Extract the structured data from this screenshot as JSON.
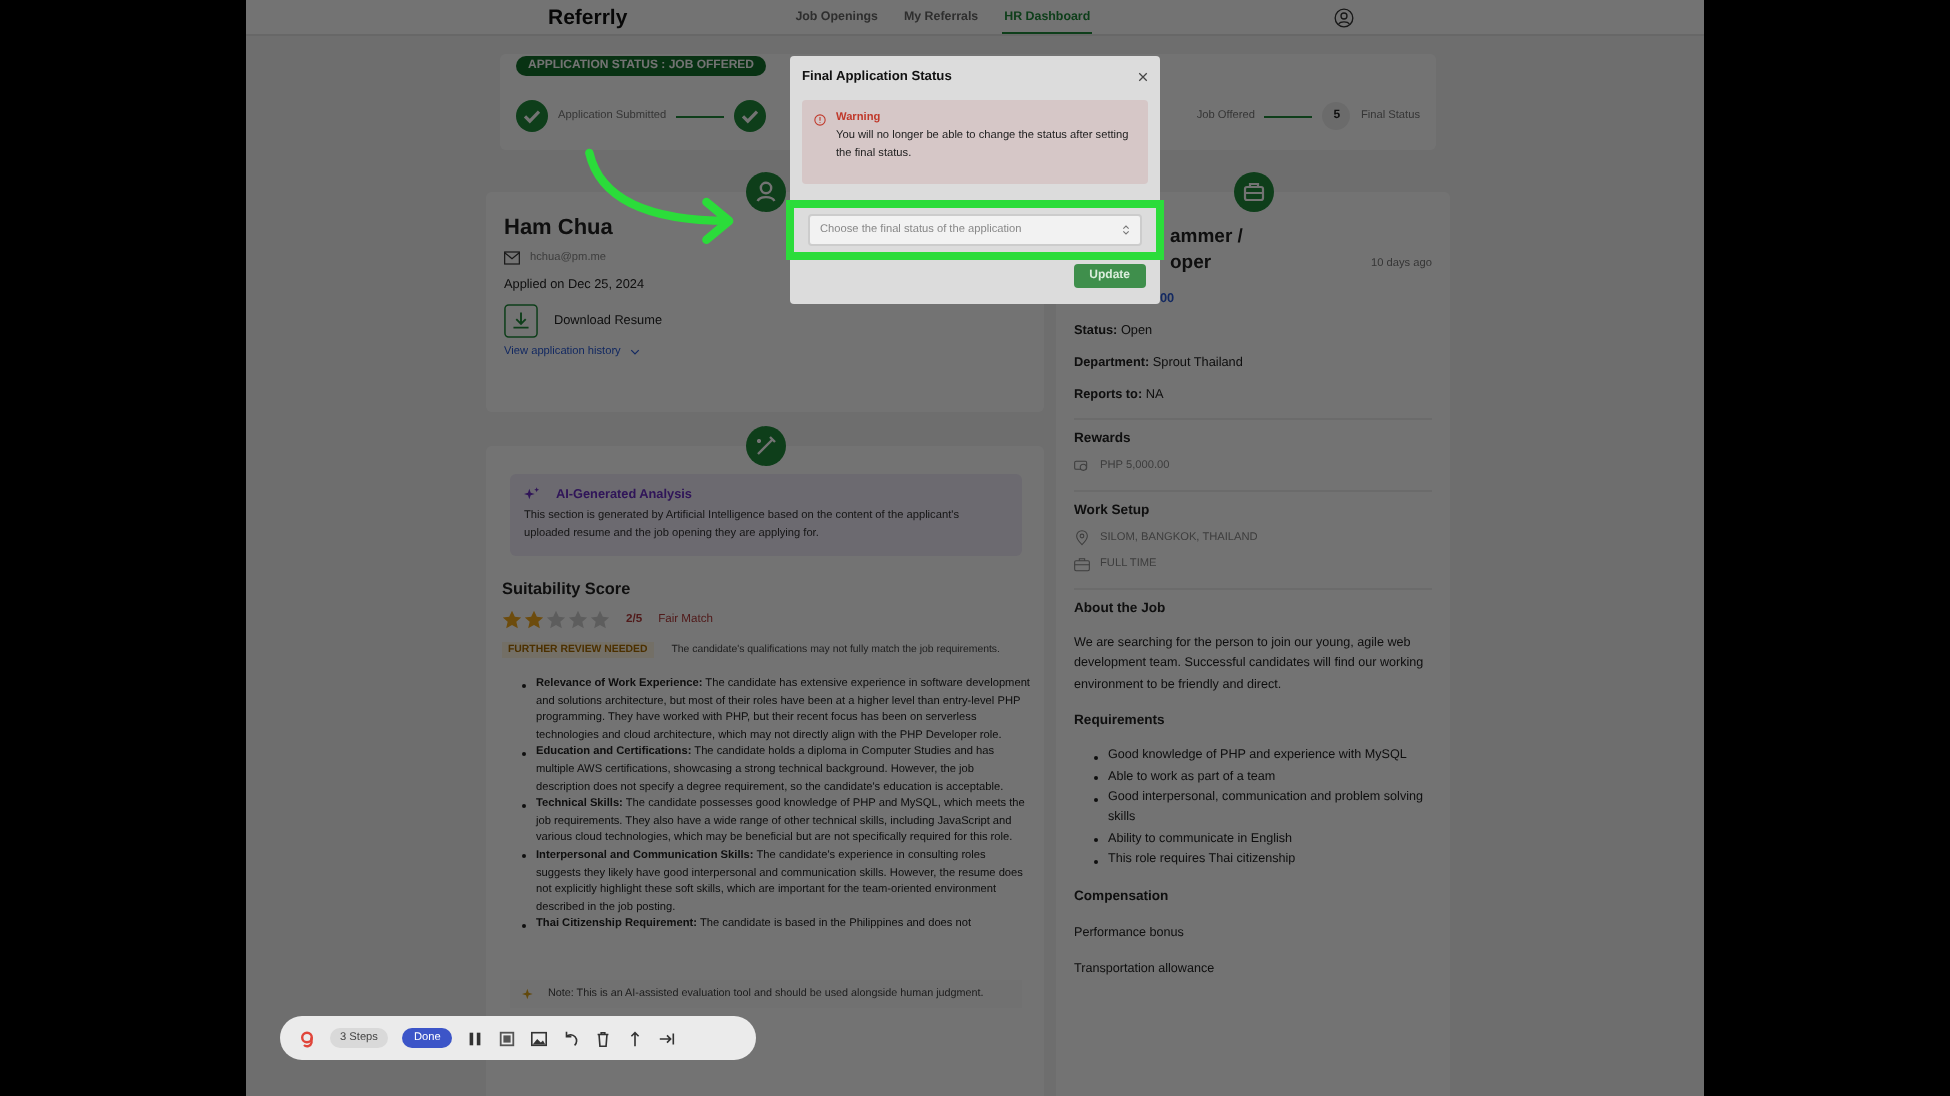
{
  "brand": {
    "name": "Referrly"
  },
  "nav": [
    {
      "label": "Job Openings",
      "selected": false
    },
    {
      "label": "My Referrals",
      "selected": false
    },
    {
      "label": "HR Dashboard",
      "selected": true
    }
  ],
  "status_badge": "APPLICATION STATUS : JOB OFFERED",
  "steps": [
    {
      "kind": "done",
      "label": "Application Submitted"
    },
    {
      "kind": "done"
    },
    {
      "kind": "label",
      "label": "Job Offered"
    },
    {
      "kind": "numbered",
      "number": "5",
      "label": "Final Status"
    }
  ],
  "candidate": {
    "name": "Ham Chua",
    "email": "hchua@pm.me",
    "applied": "Applied on Dec 25, 2024",
    "download": "Download Resume",
    "history_link": "View application history"
  },
  "analysis": {
    "title": "AI-Generated Analysis",
    "description": "This section is generated by Artificial Intelligence based on the content of the applicant's uploaded resume and the job opening they are applying for.",
    "score_title": "Suitability Score",
    "stars": 2,
    "score": "2/5",
    "match": "Fair Match",
    "review_tag": "FURTHER REVIEW NEEDED",
    "review_text": "The candidate's qualifications may not fully match the job requirements.",
    "points": [
      {
        "label": "Relevance of Work Experience:",
        "text": "The candidate has extensive experience in software development and solutions architecture, but most of their roles have been at a higher level than entry-level PHP programming. They have worked with PHP, but their recent focus has been on serverless technologies and cloud architecture, which may not directly align with the PHP Developer role."
      },
      {
        "label": "Education and Certifications:",
        "text": "The candidate holds a diploma in Computer Studies and has multiple AWS certifications, showcasing a strong technical background. However, the job description does not specify a degree requirement, so the candidate's education is acceptable."
      },
      {
        "label": "Technical Skills:",
        "text": "The candidate possesses good knowledge of PHP and MySQL, which meets the job requirements. They also have a wide range of other technical skills, including JavaScript and various cloud technologies, which may be beneficial but are not specifically required for this role."
      },
      {
        "label": "Interpersonal and Communication Skills:",
        "text": "The candidate's experience in consulting roles suggests they likely have good interpersonal and communication skills. However, the resume does not explicitly highlight these soft skills, which are important for the team-oriented environment described in the job posting."
      },
      {
        "label": "Thai Citizenship Requirement:",
        "text": "The candidate is based in the Philippines and does not"
      }
    ],
    "note": "Note: This is an AI-assisted evaluation tool and should be used alongside human judgment."
  },
  "job": {
    "title_lines": [
      "ammer /",
      "oper"
    ],
    "posted": "10 days ago",
    "salary": "00",
    "fields": [
      {
        "label": "Status:",
        "value": "Open"
      },
      {
        "label": "Department:",
        "value": "Sprout Thailand"
      },
      {
        "label": "Reports to:",
        "value": "NA"
      }
    ],
    "rewards_title": "Rewards",
    "reward": "PHP 5,000.00",
    "setup_title": "Work Setup",
    "location": "SILOM, BANGKOK, THAILAND",
    "work_type": "FULL TIME",
    "about_title": "About the Job",
    "about": "We are searching for the person to join our young, agile web development team. Successful candidates will find our working environment to be friendly and direct.",
    "requirements_title": "Requirements",
    "requirements": [
      "Good knowledge of PHP and experience with MySQL",
      "Able to work as part of a team",
      "Good interpersonal, communication and problem solving skills",
      "Ability to communicate in English",
      "This role requires Thai citizenship"
    ],
    "compensation_title": "Compensation",
    "compensation": [
      "Performance bonus",
      "Transportation allowance"
    ]
  },
  "modal": {
    "title": "Final Application Status",
    "warning_title": "Warning",
    "warning_text": "You will no longer be able to change the status after setting the final status.",
    "placeholder": "Choose the final status of the application",
    "button": "Update"
  },
  "recorder": {
    "steps": "3 Steps",
    "done": "Done"
  }
}
